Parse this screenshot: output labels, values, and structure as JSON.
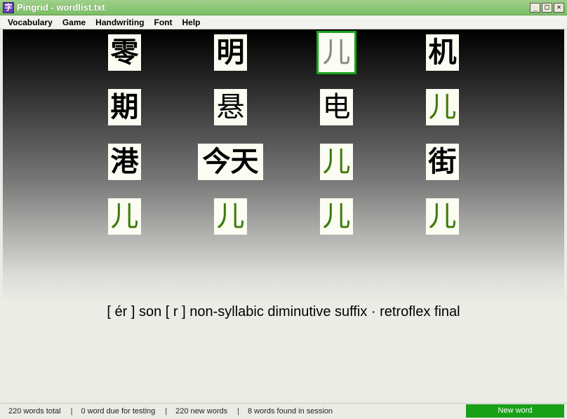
{
  "window": {
    "title": "Pingrid - wordlist.txt",
    "app_icon_glyph": "字",
    "controls": {
      "minimize": "_",
      "maximize": "□",
      "close": "✕"
    }
  },
  "menu": [
    "Vocabulary",
    "Game",
    "Handwriting",
    "Font",
    "Help"
  ],
  "grid": [
    [
      {
        "text": "零",
        "state": "normal"
      },
      {
        "text": "明",
        "state": "normal"
      },
      {
        "text": "儿",
        "state": "selected"
      },
      {
        "text": "机",
        "state": "normal"
      }
    ],
    [
      {
        "text": "期",
        "state": "normal"
      },
      {
        "text": "悬",
        "state": "normal"
      },
      {
        "text": "电",
        "state": "normal"
      },
      {
        "text": "儿",
        "state": "found"
      }
    ],
    [
      {
        "text": "港",
        "state": "normal"
      },
      {
        "text": "今天",
        "state": "normal"
      },
      {
        "text": "儿",
        "state": "found"
      },
      {
        "text": "街",
        "state": "normal"
      }
    ],
    [
      {
        "text": "儿",
        "state": "found"
      },
      {
        "text": "儿",
        "state": "found"
      },
      {
        "text": "儿",
        "state": "found"
      },
      {
        "text": "儿",
        "state": "found"
      }
    ]
  ],
  "definition": "[ ér ]  son  [ r ]  non-syllabic diminutive suffix · retroflex final",
  "status": {
    "total": "220 words total",
    "due": "0 word due for testing",
    "new": "220 new words",
    "found": "8 words found in session",
    "separator": "|",
    "new_word_button": "New word"
  },
  "colors": {
    "titlebar": "#7cbf66",
    "found_glyph": "#3d7a0a",
    "selected_border": "#1aa31a",
    "new_word_button": "#18a018"
  }
}
